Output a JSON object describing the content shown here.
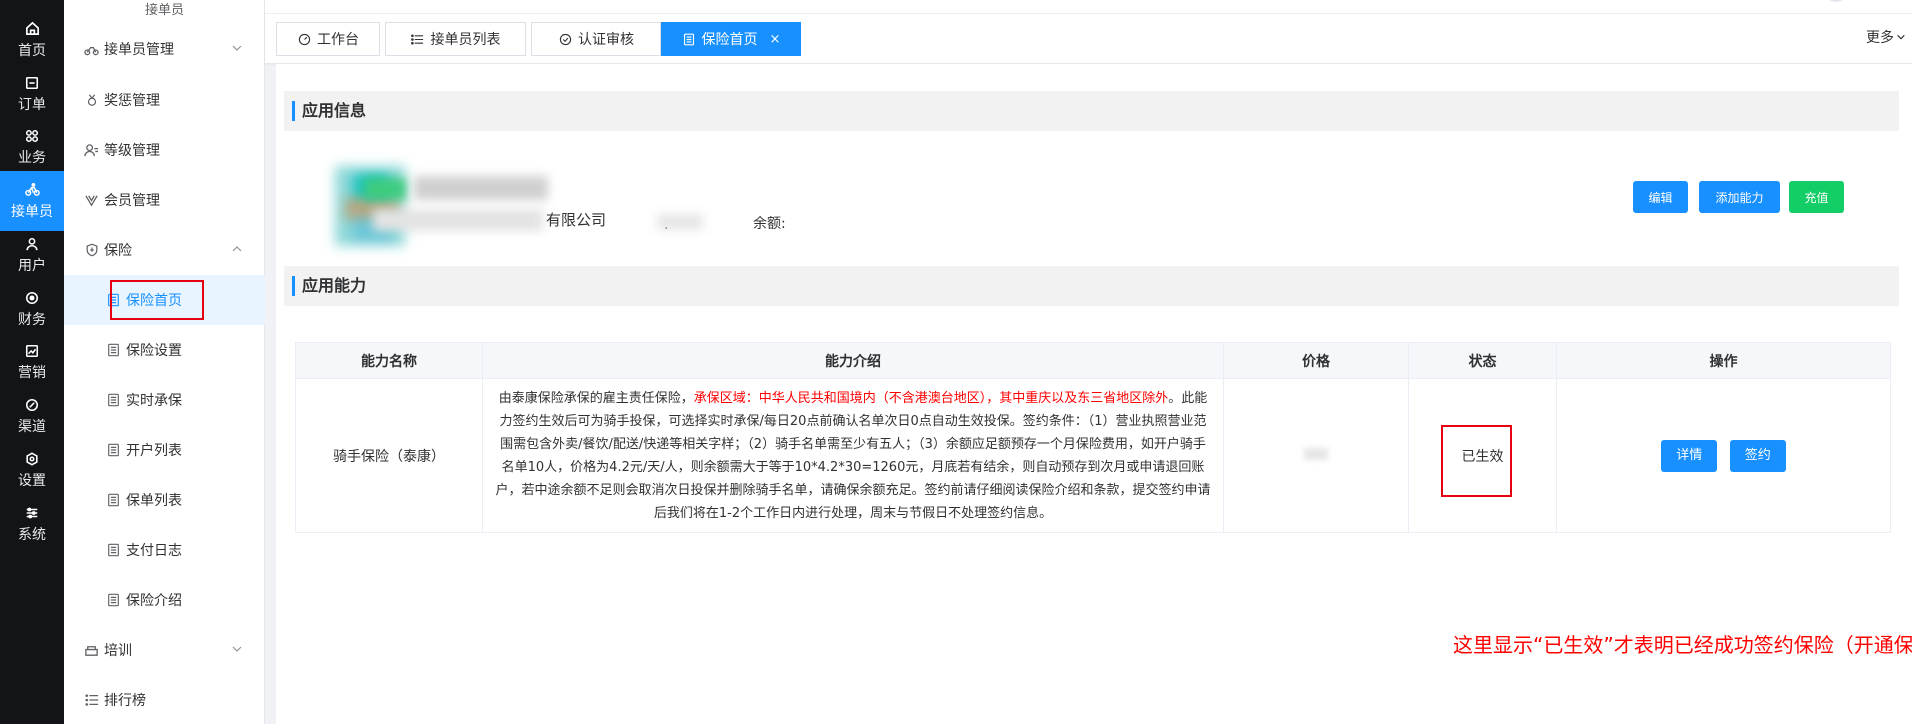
{
  "rail": {
    "items": [
      {
        "label": "首页",
        "icon": "home-icon"
      },
      {
        "label": "订单",
        "icon": "order-icon"
      },
      {
        "label": "业务",
        "icon": "business-icon"
      },
      {
        "label": "接单员",
        "icon": "rider-icon"
      },
      {
        "label": "用户",
        "icon": "user-icon"
      },
      {
        "label": "财务",
        "icon": "finance-icon"
      },
      {
        "label": "营销",
        "icon": "marketing-icon"
      },
      {
        "label": "渠道",
        "icon": "channel-icon"
      },
      {
        "label": "设置",
        "icon": "settings-icon"
      },
      {
        "label": "系统",
        "icon": "system-icon"
      }
    ],
    "active_index": 3
  },
  "sidebar": {
    "title": "接单员",
    "items": [
      {
        "label": "接单员管理",
        "icon": "bike-icon",
        "chevron": "down"
      },
      {
        "label": "奖惩管理",
        "icon": "medal-icon"
      },
      {
        "label": "等级管理",
        "icon": "user-level-icon"
      },
      {
        "label": "会员管理",
        "icon": "vip-icon"
      },
      {
        "label": "保险",
        "icon": "shield-icon",
        "chevron": "up"
      },
      {
        "label": "保险首页",
        "icon": "doc-icon"
      },
      {
        "label": "保险设置",
        "icon": "doc-icon"
      },
      {
        "label": "实时承保",
        "icon": "doc-icon"
      },
      {
        "label": "开户列表",
        "icon": "doc-icon"
      },
      {
        "label": "保单列表",
        "icon": "doc-icon"
      },
      {
        "label": "支付日志",
        "icon": "doc-icon"
      },
      {
        "label": "保险介绍",
        "icon": "doc-icon"
      },
      {
        "label": "培训",
        "icon": "training-icon",
        "chevron": "down"
      },
      {
        "label": "排行榜",
        "icon": "list-icon"
      }
    ],
    "selected": "保险首页"
  },
  "tabs": [
    {
      "label": "工作台",
      "icon": "dashboard-icon"
    },
    {
      "label": "接单员列表",
      "icon": "list-icon"
    },
    {
      "label": "认证审核",
      "icon": "check-circle-icon"
    },
    {
      "label": "保险首页",
      "icon": "doc-icon",
      "active": true,
      "close": "×"
    }
  ],
  "more_label": "更多",
  "app_info": {
    "section_title": "应用信息",
    "company_suffix": "有限公司",
    "balance_label": "余额:",
    "balance_dot": ".",
    "buttons": {
      "edit": "编辑",
      "add": "添加能力",
      "recharge": "充值"
    }
  },
  "abilities": {
    "section_title": "应用能力",
    "columns": [
      "能力名称",
      "能力介绍",
      "价格",
      "状态",
      "操作"
    ],
    "rows": [
      {
        "name": "骑手保险（泰康）",
        "desc_prefix": "由泰康保险承保的雇主责任保险，",
        "desc_red": "承保区域：中华人民共和国境内（不含港澳台地区），其中重庆以及东三省地区除外",
        "desc_rest": "。此能力签约生效后可为骑手投保，可选择实时承保/每日20点前确认名单次日0点自动生效投保。签约条件：（1）营业执照营业范围需包含外卖/餐饮/配送/快递等相关字样；（2）骑手名单需至少有五人；（3）余额应足额预存一个月保险费用，如开户骑手名单10人，价格为4.2元/天/人，则余额需大于等于10*4.2*30=1260元，月底若有结余，则自动预存到次月或申请退回账户，若中途余额不足则会取消次日投保并删除骑手名单，请确保余额充足。签约前请仔细阅读保险介绍和条款，提交签约申请后我们将在1-2个工作日内进行处理，周末与节假日不处理签约信息。",
        "status": "已生效",
        "actions": {
          "detail": "详情",
          "sign": "签约"
        }
      }
    ]
  },
  "annotation": "这里显示“已生效”才表明已经成功签约保险（开通保险）",
  "colors": {
    "primary": "#1890ff",
    "success": "#13ce66",
    "highlight_red": "#e60012",
    "rail_bg": "#121417"
  }
}
